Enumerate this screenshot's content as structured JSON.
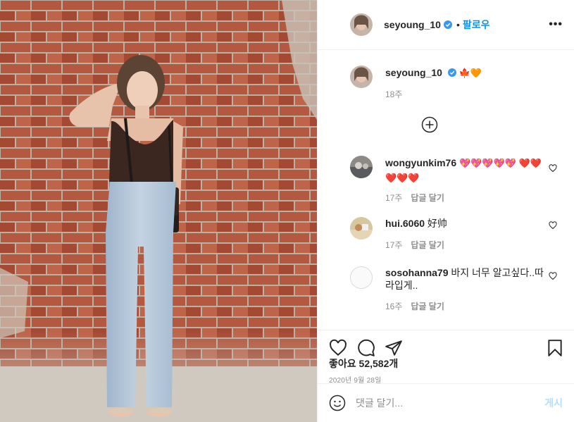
{
  "header": {
    "username": "seyoung_10",
    "dot": "•",
    "follow_label": "팔로우",
    "more_label": "•••"
  },
  "caption": {
    "username": "seyoung_10",
    "emojis": "🍁🧡",
    "time": "18주"
  },
  "comments": [
    {
      "username": "wongyunkim76",
      "text": "💖💖💖💖💖 ❤️❤️❤️❤️❤️",
      "time": "17주",
      "reply_label": "답글 달기"
    },
    {
      "username": "hui.6060",
      "text": "好帅",
      "time": "17주",
      "reply_label": "답글 달기"
    },
    {
      "username": "sosohanna79",
      "text": "바지 너무 알고싶다..따라입게..",
      "time": "16주",
      "reply_label": "답글 달기"
    }
  ],
  "likes": {
    "label": "좋아요",
    "count": "52,582개"
  },
  "date": "2020년 9월 28일",
  "add_comment": {
    "placeholder": "댓글 달기...",
    "post_label": "게시"
  },
  "colors": {
    "link_blue": "#0095f6",
    "post_disabled": "#b2dffc",
    "muted": "#8e8e8e",
    "border": "#efefef",
    "verified": "#3897f0"
  },
  "icons": [
    "verified-badge-icon",
    "plus-circle-icon",
    "heart-outline-icon",
    "comment-icon",
    "share-icon",
    "bookmark-icon",
    "emoji-icon",
    "more-icon"
  ]
}
